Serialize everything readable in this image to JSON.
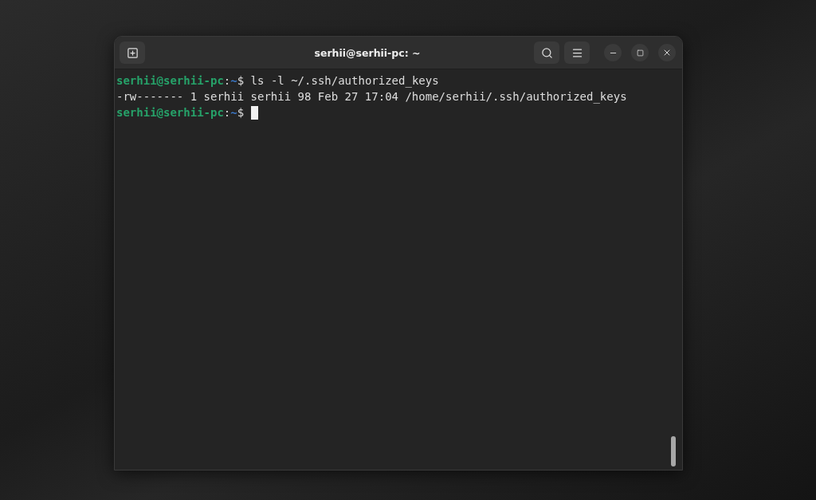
{
  "window": {
    "title": "serhii@serhii-pc: ~"
  },
  "terminal": {
    "lines": [
      {
        "kind": "prompt",
        "user_host": "serhii@serhii-pc",
        "separator": ":",
        "path": "~",
        "symbol": "$",
        "command": "ls -l ~/.ssh/authorized_keys",
        "cursor": false
      },
      {
        "kind": "output",
        "text": "-rw------- 1 serhii serhii 98 Feb 27 17:04 /home/serhii/.ssh/authorized_keys"
      },
      {
        "kind": "prompt",
        "user_host": "serhii@serhii-pc",
        "separator": ":",
        "path": "~",
        "symbol": "$",
        "cursor": true
      }
    ]
  }
}
